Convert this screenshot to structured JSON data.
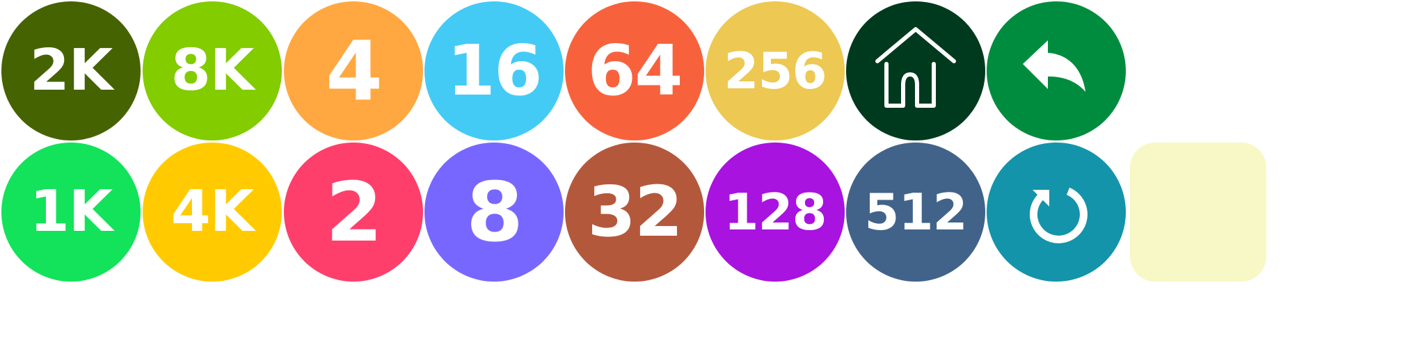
{
  "tiles": {
    "t2k": {
      "label": "2K",
      "color": "#456300"
    },
    "t8k": {
      "label": "8K",
      "color": "#82cc00"
    },
    "t4": {
      "label": "4",
      "color": "#ffa841"
    },
    "t16": {
      "label": "16",
      "color": "#44cbf5"
    },
    "t64": {
      "label": "64",
      "color": "#f7623d"
    },
    "t256": {
      "label": "256",
      "color": "#edc852"
    },
    "t1k": {
      "label": "1K",
      "color": "#12e35a"
    },
    "t4k": {
      "label": "4K",
      "color": "#ffcb00"
    },
    "t2": {
      "label": "2",
      "color": "#ff3f6b"
    },
    "t8": {
      "label": "8",
      "color": "#7867ff"
    },
    "t32": {
      "label": "32",
      "color": "#b4583c"
    },
    "t128": {
      "label": "128",
      "color": "#a813e0"
    },
    "t512": {
      "label": "512",
      "color": "#41638a"
    }
  },
  "controls": {
    "home": {
      "icon": "home-icon",
      "color": "#003a1e"
    },
    "undo": {
      "icon": "undo-icon",
      "color": "#008c3e"
    },
    "restart": {
      "icon": "restart-icon",
      "color": "#1394aa"
    }
  },
  "blank_tile": {
    "color": "#f7f8c6"
  }
}
